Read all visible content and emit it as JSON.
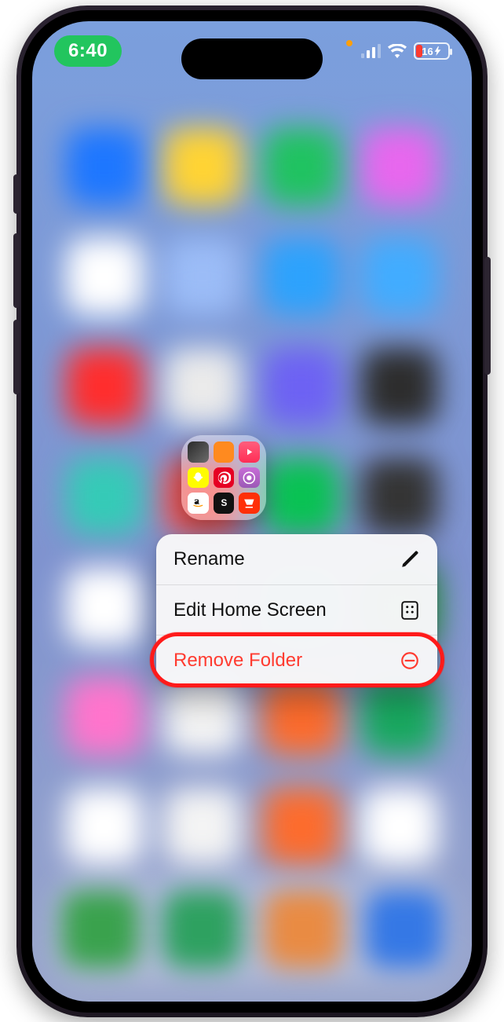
{
  "status": {
    "time": "6:40",
    "mic_active": true,
    "battery_percent": "16",
    "battery_charging": true
  },
  "folder": {
    "apps": [
      "app-1",
      "audible",
      "apple-music",
      "snapchat",
      "pinterest",
      "podcasts",
      "amazon",
      "shortcut-s",
      "doordash"
    ]
  },
  "menu": {
    "items": [
      {
        "label": "Rename",
        "icon": "pencil-icon",
        "destructive": false
      },
      {
        "label": "Edit Home Screen",
        "icon": "apps-icon",
        "destructive": false
      },
      {
        "label": "Remove Folder",
        "icon": "minus-circle-icon",
        "destructive": true
      }
    ]
  },
  "annotation": {
    "highlight_item_index": 2
  }
}
